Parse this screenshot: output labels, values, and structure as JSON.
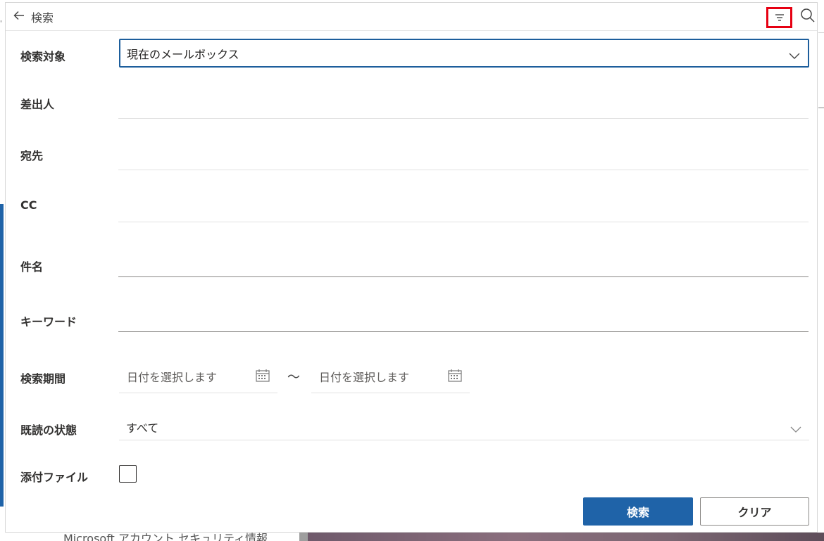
{
  "header": {
    "back_label": "検索",
    "back_icon": "arrow-left-icon",
    "filter_icon": "filter-icon",
    "search_icon": "search-icon",
    "highlight_color": "#e60012"
  },
  "form": {
    "scope": {
      "label": "検索対象",
      "value": "現在のメールボックス"
    },
    "from": {
      "label": "差出人",
      "value": ""
    },
    "to": {
      "label": "宛先",
      "value": ""
    },
    "cc": {
      "label": "CC",
      "value": ""
    },
    "subject": {
      "label": "件名",
      "value": ""
    },
    "keyword": {
      "label": "キーワード",
      "value": ""
    },
    "period": {
      "label": "検索期間",
      "start_placeholder": "日付を選択します",
      "end_placeholder": "日付を選択します",
      "separator": "～"
    },
    "read_status": {
      "label": "既読の状態",
      "value": "すべて"
    },
    "attachment": {
      "label": "添付ファイル",
      "checked": false
    }
  },
  "buttons": {
    "search": "検索",
    "clear": "クリア",
    "primary_color": "#1f63a8"
  },
  "background": {
    "list_item_text": "Microsoft アカウント セキュリティ情報..."
  }
}
